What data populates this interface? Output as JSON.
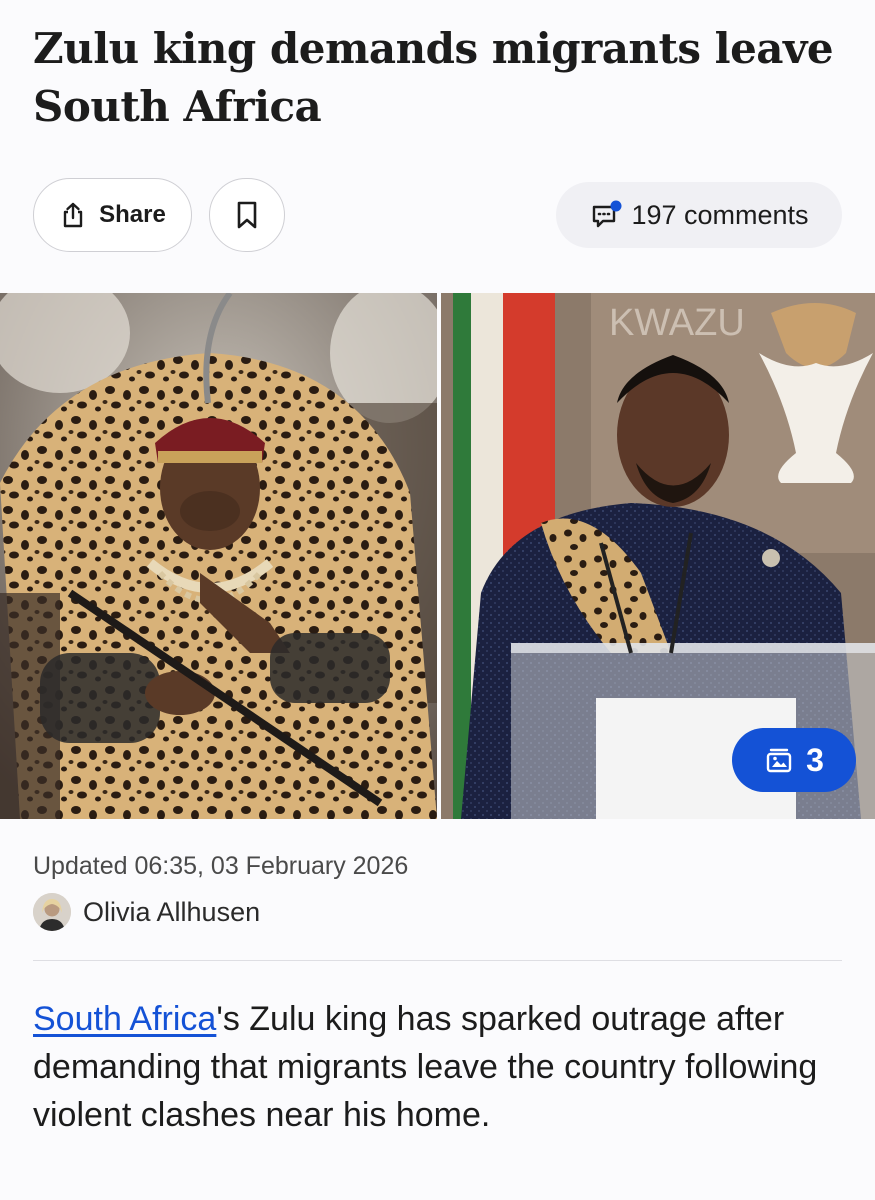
{
  "article": {
    "headline": "Zulu king demands migrants leave South Africa",
    "updated": "Updated 06:35, 03 February 2026",
    "author": "Olivia Allhusen",
    "body_link": "South Africa",
    "body_rest": "'s Zulu king has sparked outrage after demanding that migrants leave the country following violent clashes near his home."
  },
  "toolbar": {
    "share_label": "Share",
    "share_icon": "share-icon",
    "bookmark_icon": "bookmark-icon",
    "comments_label": "197 comments",
    "comments_icon": "comment-icon"
  },
  "gallery": {
    "count": "3",
    "icon": "gallery-icon",
    "background_text": "KWAZU"
  },
  "colors": {
    "link": "#1452d6",
    "badge": "#1452d6"
  }
}
